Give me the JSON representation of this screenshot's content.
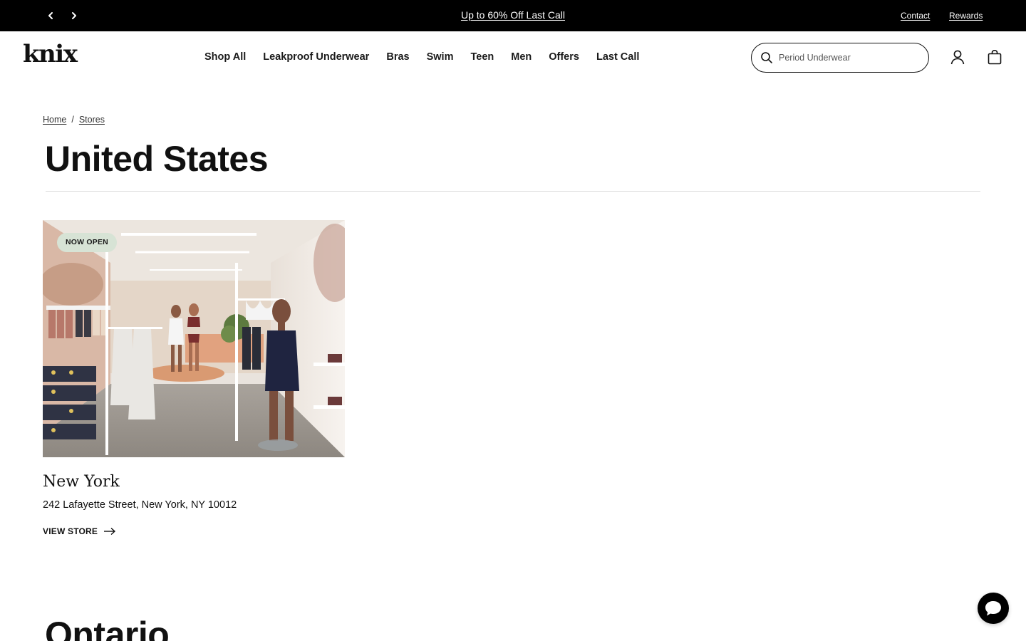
{
  "announcement": {
    "promo_text": "Up to 60% Off Last Call",
    "contact_label": "Contact",
    "rewards_label": "Rewards",
    "background": "#000000",
    "text_color": "#ffffff"
  },
  "header": {
    "logo_text": "knix",
    "nav": [
      "Shop All",
      "Leakproof Underwear",
      "Bras",
      "Swim",
      "Teen",
      "Men",
      "Offers",
      "Last Call"
    ],
    "search": {
      "placeholder": "Period Underwear",
      "value": ""
    },
    "icons": [
      "search-icon",
      "account-icon",
      "cart-icon"
    ]
  },
  "breadcrumb": {
    "home": "Home",
    "separator": "/",
    "stores": "Stores"
  },
  "page": {
    "title": "United States"
  },
  "stores": [
    {
      "badge": "NOW OPEN",
      "badge_color": "#d7e3d5",
      "name": "New York",
      "address": "242 Lafayette Street, New York, NY 10012",
      "cta": "VIEW STORE"
    }
  ],
  "next_region": {
    "title": "Ontario"
  },
  "chat": {
    "icon": "chat-bubble-icon"
  }
}
